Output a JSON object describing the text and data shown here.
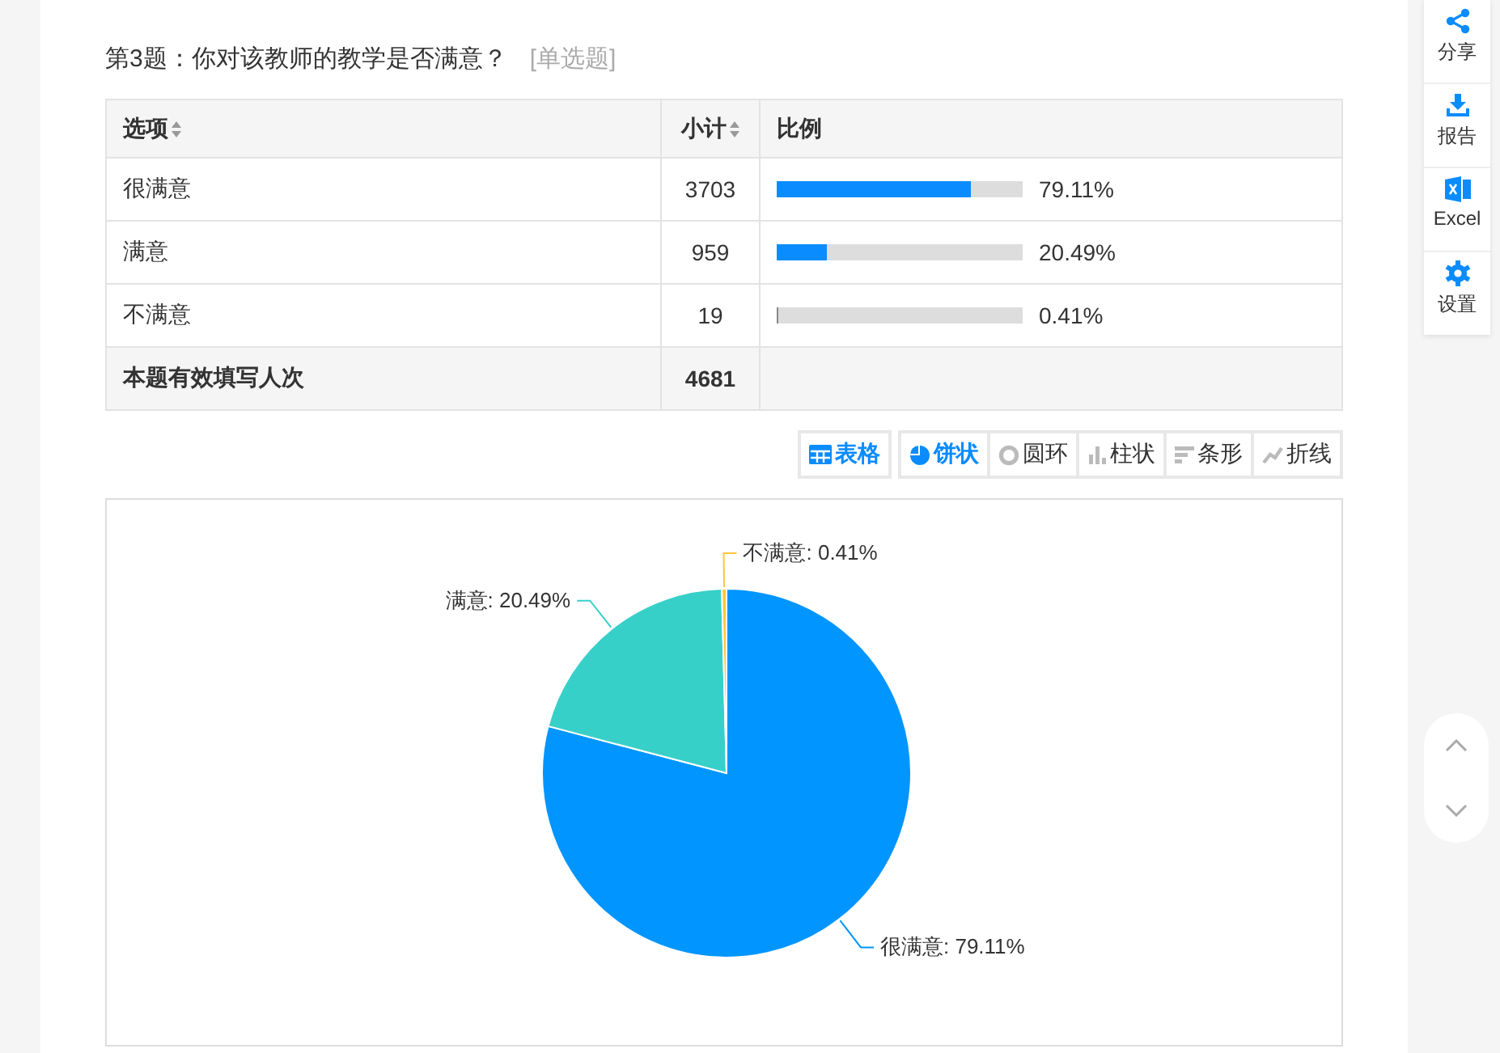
{
  "question": {
    "title": "第3题：你对该教师的教学是否满意？",
    "type": "[单选题]"
  },
  "table": {
    "columns": [
      {
        "label": "选项",
        "sortable": true
      },
      {
        "label": "小计",
        "sortable": true
      },
      {
        "label": "比例",
        "sortable": false
      }
    ],
    "rows": [
      {
        "option": "很满意",
        "count": "3703",
        "level": 0.7911,
        "percent": "79.11%"
      },
      {
        "option": "满意",
        "count": "959",
        "level": 0.2049,
        "percent": "20.49%"
      },
      {
        "option": "不满意",
        "count": "19",
        "level": 0.0041,
        "percent": "0.41%"
      }
    ],
    "total": {
      "label": "本题有效填写人次",
      "count": "4681"
    }
  },
  "toolbar": [
    {
      "kind": "table",
      "label": "表格",
      "selected": true
    },
    {
      "kind": "pie",
      "label": "饼状",
      "selected": true
    },
    {
      "kind": "ring",
      "label": "圆环",
      "selected": false
    },
    {
      "kind": "column",
      "label": "柱状",
      "selected": false
    },
    {
      "kind": "bar",
      "label": "条形",
      "selected": false
    },
    {
      "kind": "line",
      "label": "折线",
      "selected": false
    }
  ],
  "chart": {
    "chart_data": {
      "type": "pie",
      "values": [
        79.11,
        20.49,
        0.41
      ],
      "colors": [
        "#0095ff",
        "#37d0c9",
        "#ffc53d"
      ],
      "value_labels": [
        "很满意: 79.11%",
        "满意: 20.49%",
        "不满意: 0.41%"
      ]
    }
  },
  "sidebar": [
    {
      "kind": "share",
      "label": "分享"
    },
    {
      "kind": "download",
      "label": "报告"
    },
    {
      "kind": "excel",
      "label": "Excel"
    },
    {
      "kind": "settings",
      "label": "设置"
    }
  ]
}
